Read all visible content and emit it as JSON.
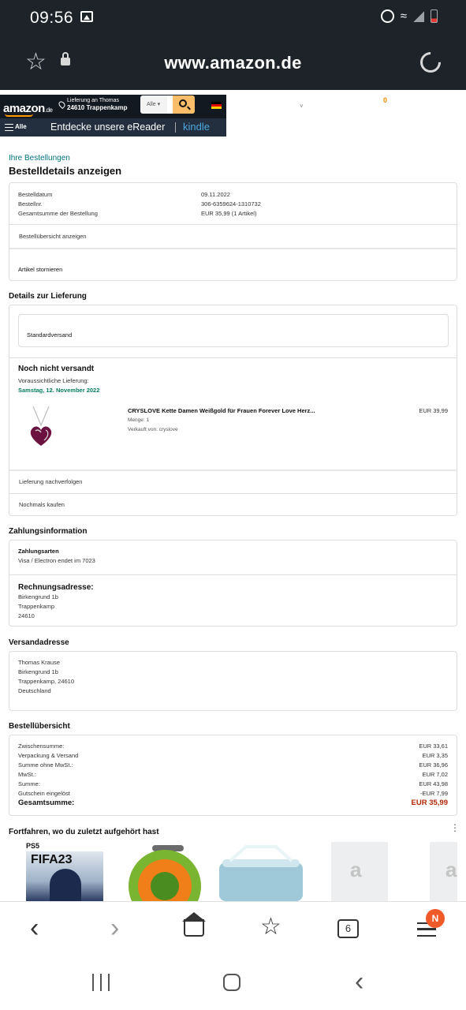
{
  "statusbar": {
    "time": "09:56"
  },
  "browser": {
    "url": "www.amazon.de"
  },
  "amazon_header": {
    "logo": "amazon",
    "logo_suffix": ".de",
    "deliver_line1": "Lieferung an Thomas",
    "deliver_line2": "24610 Trappenkamp",
    "search_category": "Alle",
    "cart_count": "0",
    "menu_label": "Alle",
    "promo_text": "Entdecke unsere eReader",
    "kindle_text": "kindle"
  },
  "order": {
    "breadcrumb": "Ihre Bestellungen",
    "title": "Bestelldetails anzeigen",
    "info": [
      {
        "label": "Bestelldatum",
        "value": "09.11.2022"
      },
      {
        "label": "Bestellnr.",
        "value": "306-6359624-1310732"
      },
      {
        "label": "Gesamtsumme der Bestellung",
        "value": "EUR 35,99 (1 Artikel)"
      }
    ],
    "overview_link": "Bestellübersicht anzeigen",
    "cancel_label": "Artikel stornieren"
  },
  "delivery": {
    "section_title": "Details zur Lieferung",
    "shipping_method": "Standardversand",
    "status": "Noch nicht versandt",
    "expected_label": "Voraussichtliche Lieferung:",
    "expected_date": "Samstag, 12. November 2022",
    "item_title": "CRYSLOVE Kette Damen Weißgold für Frauen Forever Love Herz...",
    "item_qty": "Menge: 1",
    "item_seller": "Verkauft von: cryslove",
    "item_price": "EUR 39,99",
    "track_link": "Lieferung nachverfolgen",
    "buy_again_link": "Nochmals kaufen"
  },
  "payment": {
    "section_title": "Zahlungsinformation",
    "methods_label": "Zahlungsarten",
    "method_value": "Visa / Electron endet im 7023",
    "billing_title": "Rechnungsadresse:",
    "billing_lines": [
      "Birkengrund 1b",
      "Trappenkamp",
      "24610"
    ]
  },
  "shipping_address": {
    "section_title": "Versandadresse",
    "lines": [
      "Thomas Krause",
      "Birkengrund 1b",
      "Trappenkamp, 24610",
      "Deutschland"
    ]
  },
  "summary": {
    "section_title": "Bestellübersicht",
    "rows": [
      {
        "label": "Zwischensumme:",
        "value": "EUR 33,61"
      },
      {
        "label": "Verpackung & Versand",
        "value": "EUR 3,35"
      },
      {
        "label": "Summe ohne MwSt.:",
        "value": "EUR 36,96"
      },
      {
        "label": "MwSt.:",
        "value": "EUR 7,02"
      },
      {
        "label": "Summe:",
        "value": "EUR 43,98"
      },
      {
        "label": "Gutschein eingelöst",
        "value": "-EUR 7,99"
      }
    ],
    "total_label": "Gesamtsumme:",
    "total_value": "EUR 35,99"
  },
  "continue": {
    "section_title": "Fortfahren, wo du zuletzt aufgehört hast",
    "ps5_label": "PS5",
    "fifa_label": "FIFA23"
  },
  "browser_bar": {
    "tab_count": "6",
    "profile_initial": "N"
  },
  "colors": {
    "accent_link": "#007185",
    "green": "#067d62",
    "price_red": "#b12704",
    "amazon_orange": "#ff9900"
  }
}
